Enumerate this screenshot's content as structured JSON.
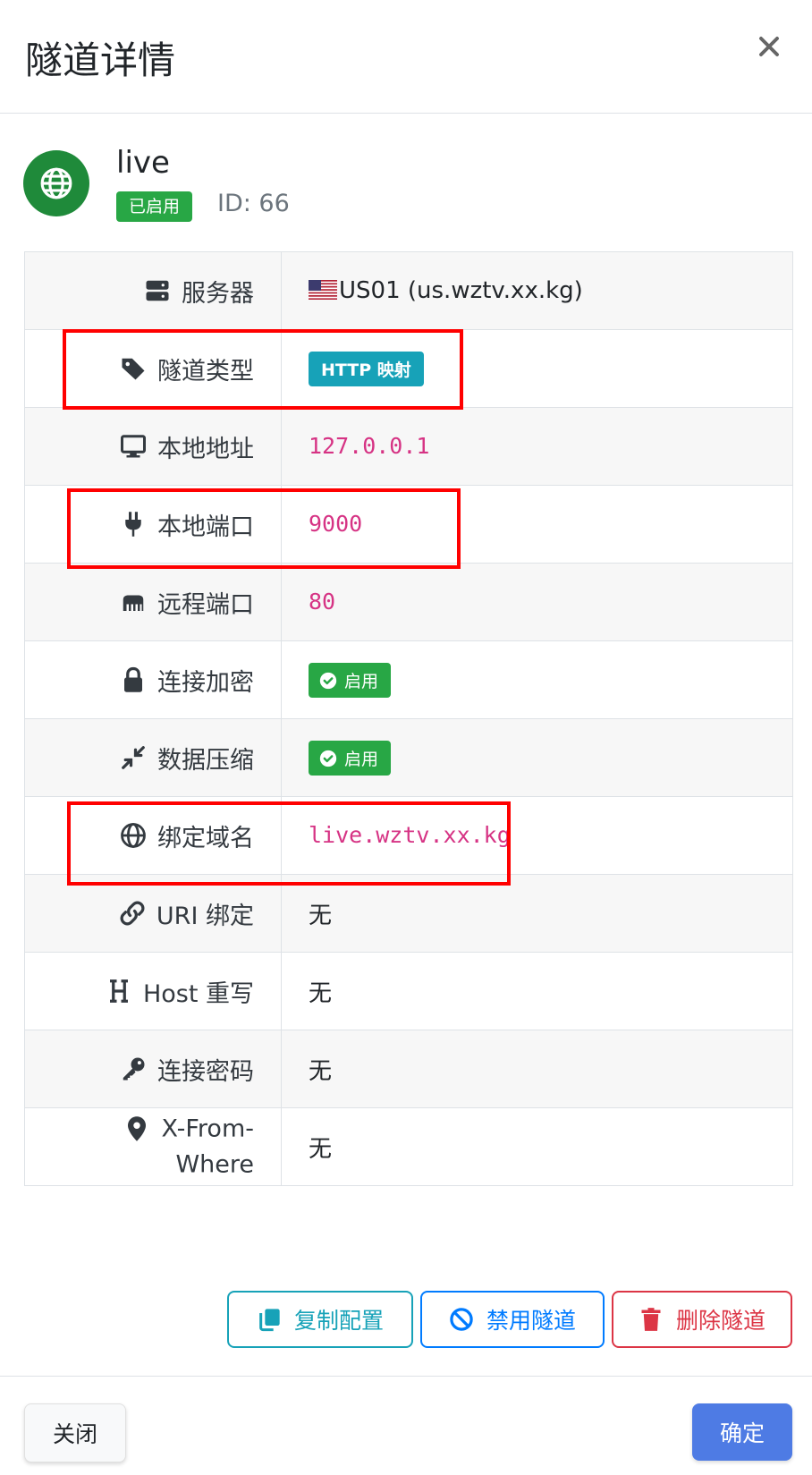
{
  "modal": {
    "title": "隧道详情"
  },
  "tunnel": {
    "name": "live",
    "status": "已启用",
    "id_text": "ID: 66"
  },
  "details": {
    "server": {
      "label": "服务器",
      "value": "US01 (us.wztv.xx.kg)",
      "flag": "us-flag"
    },
    "type": {
      "label": "隧道类型",
      "value": "HTTP 映射"
    },
    "local_addr": {
      "label": "本地地址",
      "value": "127.0.0.1"
    },
    "local_port": {
      "label": "本地端口",
      "value": "9000"
    },
    "remote_port": {
      "label": "远程端口",
      "value": "80"
    },
    "encryption": {
      "label": "连接加密",
      "value": "启用"
    },
    "compression": {
      "label": "数据压缩",
      "value": "启用"
    },
    "domain": {
      "label": "绑定域名",
      "value": "live.wztv.xx.kg"
    },
    "uri": {
      "label": "URI 绑定",
      "value": "无"
    },
    "host": {
      "label": "Host 重写",
      "value": "无"
    },
    "password": {
      "label": "连接密码",
      "value": "无"
    },
    "xfrom": {
      "label_1": "X-From-",
      "label_2": "Where",
      "value": "无"
    }
  },
  "actions": {
    "copy": "复制配置",
    "disable": "禁用隧道",
    "delete": "删除隧道"
  },
  "footer": {
    "close": "关闭",
    "ok": "确定"
  },
  "icons": [
    "close-icon",
    "globe-icon",
    "server-icon",
    "tag-icon",
    "desktop-icon",
    "plug-icon",
    "network-icon",
    "lock-icon",
    "compress-icon",
    "globe-icon",
    "link-icon",
    "heading-icon",
    "key-icon",
    "map-marker-icon",
    "check-circle-icon",
    "copy-icon",
    "ban-icon",
    "trash-icon"
  ],
  "colors": {
    "success": "#28a745",
    "info": "#17a2b8",
    "primary": "#007bff",
    "danger": "#dc3545",
    "code": "#d63384",
    "highlight": "#ff0000",
    "ok_button": "#4e7be4"
  }
}
